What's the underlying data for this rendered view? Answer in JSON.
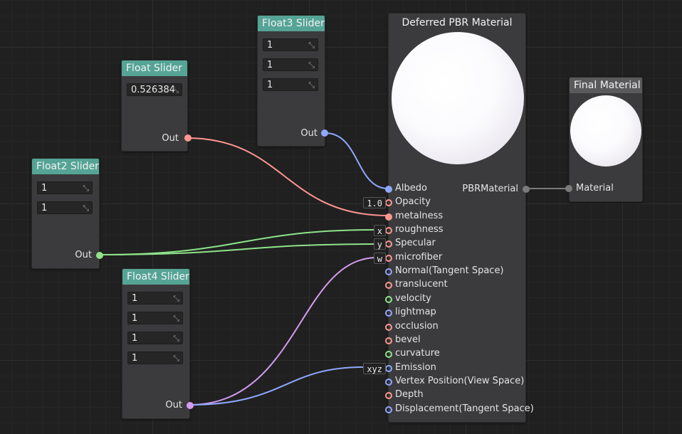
{
  "nodes": {
    "float_slider": {
      "title": "Float Slider",
      "value": "0.526384",
      "out": "Out"
    },
    "float2_slider": {
      "title": "Float2 Slider",
      "values": [
        "1",
        "1"
      ],
      "out": "Out"
    },
    "float3_slider": {
      "title": "Float3 Slider",
      "values": [
        "1",
        "1",
        "1"
      ],
      "out": "Out"
    },
    "float4_slider": {
      "title": "Float4 Slider",
      "values": [
        "1",
        "1",
        "1",
        "1"
      ],
      "out": "Out"
    },
    "pbr": {
      "title": "Deferred PBR Material",
      "output": "PBRMaterial",
      "inputs": [
        {
          "label": "Albedo",
          "color": "#8fa8ff",
          "connected": true
        },
        {
          "label": "Opacity",
          "color": "#ff9690",
          "connected": false,
          "swizzle": "1.0"
        },
        {
          "label": "metalness",
          "color": "#ff9690",
          "connected": true
        },
        {
          "label": "roughness",
          "color": "#ff9690",
          "connected": false,
          "swizzle": "x"
        },
        {
          "label": "Specular",
          "color": "#ff9690",
          "connected": false,
          "swizzle": "y"
        },
        {
          "label": "microfiber",
          "color": "#ff9690",
          "connected": false,
          "swizzle": "w"
        },
        {
          "label": "Normal(Tangent Space)",
          "color": "#8fa8ff",
          "connected": false
        },
        {
          "label": "translucent",
          "color": "#ff9690",
          "connected": false
        },
        {
          "label": "velocity",
          "color": "#8fe38a",
          "connected": false
        },
        {
          "label": "lightmap",
          "color": "#8fa8ff",
          "connected": false
        },
        {
          "label": "occlusion",
          "color": "#ff9690",
          "connected": false
        },
        {
          "label": "bevel",
          "color": "#ff9690",
          "connected": false
        },
        {
          "label": "curvature",
          "color": "#8fe38a",
          "connected": false
        },
        {
          "label": "Emission",
          "color": "#8fa8ff",
          "connected": false,
          "swizzle": "xyz"
        },
        {
          "label": "Vertex Position(View Space)",
          "color": "#8fa8ff",
          "connected": false
        },
        {
          "label": "Depth",
          "color": "#ff9690",
          "connected": false
        },
        {
          "label": "Displacement(Tangent Space)",
          "color": "#8fa8ff",
          "connected": false
        }
      ]
    },
    "final": {
      "title": "Final Material",
      "input": "Material"
    }
  },
  "colors": {
    "float": "#ff9690",
    "float2": "#8fe38a",
    "float3": "#8fa8ff",
    "float4": "#d49cf2",
    "material": "#7a7a7a",
    "header": "#55a496"
  }
}
